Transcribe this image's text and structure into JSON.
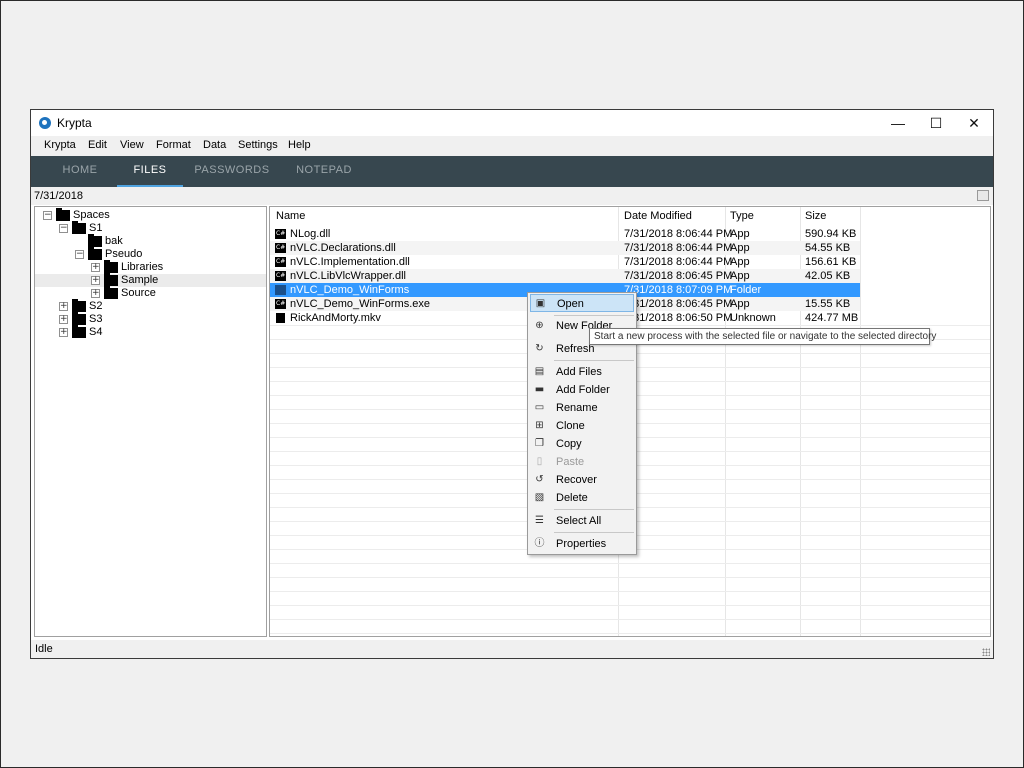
{
  "window": {
    "title": "Krypta",
    "minimize": "—",
    "maximize": "☐",
    "close": "✕"
  },
  "menu": [
    "Krypta",
    "Edit",
    "View",
    "Format",
    "Data",
    "Settings",
    "Help"
  ],
  "tabs": [
    {
      "label": "HOME",
      "active": false
    },
    {
      "label": "FILES",
      "active": true
    },
    {
      "label": "PASSWORDS",
      "active": false
    },
    {
      "label": "NOTEPAD",
      "active": false
    }
  ],
  "date_label": "7/31/2018",
  "tree": [
    {
      "label": "Spaces",
      "expander": "−"
    },
    {
      "label": "S1",
      "expander": "−"
    },
    {
      "label": "bak",
      "expander": ""
    },
    {
      "label": "Pseudo",
      "expander": "−"
    },
    {
      "label": "Libraries",
      "expander": "+"
    },
    {
      "label": "Sample",
      "expander": "+",
      "selected": true
    },
    {
      "label": "Source",
      "expander": "+"
    },
    {
      "label": "S2",
      "expander": "+"
    },
    {
      "label": "S3",
      "expander": "+"
    },
    {
      "label": "S4",
      "expander": "+"
    }
  ],
  "columns": [
    "Name",
    "Date Modified",
    "Type",
    "Size"
  ],
  "files": [
    {
      "name": "NLog.dll",
      "date": "7/31/2018 8:06:44 PM",
      "type": "App",
      "size": "590.94 KB",
      "icon": "app-file-icon"
    },
    {
      "name": "nVLC.Declarations.dll",
      "date": "7/31/2018 8:06:44 PM",
      "type": "App",
      "size": "54.55 KB",
      "icon": "app-file-icon"
    },
    {
      "name": "nVLC.Implementation.dll",
      "date": "7/31/2018 8:06:44 PM",
      "type": "App",
      "size": "156.61 KB",
      "icon": "app-file-icon"
    },
    {
      "name": "nVLC.LibVlcWrapper.dll",
      "date": "7/31/2018 8:06:45 PM",
      "type": "App",
      "size": "42.05 KB",
      "icon": "app-file-icon"
    },
    {
      "name": "nVLC_Demo_WinForms",
      "date": "7/31/2018 8:07:09 PM",
      "type": "Folder",
      "size": "",
      "icon": "folder-icon",
      "selected": true
    },
    {
      "name": "nVLC_Demo_WinForms.exe",
      "date": "7/31/2018 8:06:45 PM",
      "type": "App",
      "size": "15.55 KB",
      "icon": "app-file-icon"
    },
    {
      "name": "RickAndMorty.mkv",
      "date": "7/31/2018 8:06:50 PM",
      "type": "Unknown",
      "size": "424.77 MB",
      "icon": "document-icon"
    }
  ],
  "context_menu": [
    {
      "label": "Open",
      "icon": "open-icon",
      "glyph": "▣",
      "highlight": true
    },
    {
      "label": "New Folder",
      "icon": "add-circle-icon",
      "glyph": "⊕"
    },
    {
      "label": "Refresh",
      "icon": "refresh-icon",
      "glyph": "↻"
    },
    {
      "label": "Add Files",
      "icon": "add-file-icon",
      "glyph": "▤"
    },
    {
      "label": "Add Folder",
      "icon": "add-folder-icon",
      "glyph": "▬"
    },
    {
      "label": "Rename",
      "icon": "rename-icon",
      "glyph": "▭"
    },
    {
      "label": "Clone",
      "icon": "clone-icon",
      "glyph": "⊞"
    },
    {
      "label": "Copy",
      "icon": "copy-icon",
      "glyph": "❐"
    },
    {
      "label": "Paste",
      "icon": "paste-icon",
      "glyph": "▯",
      "disabled": true
    },
    {
      "label": "Recover",
      "icon": "recover-icon",
      "glyph": "↺"
    },
    {
      "label": "Delete",
      "icon": "delete-icon",
      "glyph": "▧"
    },
    {
      "label": "Select All",
      "icon": "select-all-icon",
      "glyph": "☰"
    },
    {
      "label": "Properties",
      "icon": "info-icon",
      "glyph": "ⓘ"
    }
  ],
  "tooltip": "Start a new process with the selected file or navigate to the selected directory",
  "status": "Idle",
  "colors": {
    "tab_bar": "#37474f",
    "tab_underline": "#4fa3e0",
    "selection": "#3399ff",
    "menu_highlight": "#cce4f7"
  }
}
